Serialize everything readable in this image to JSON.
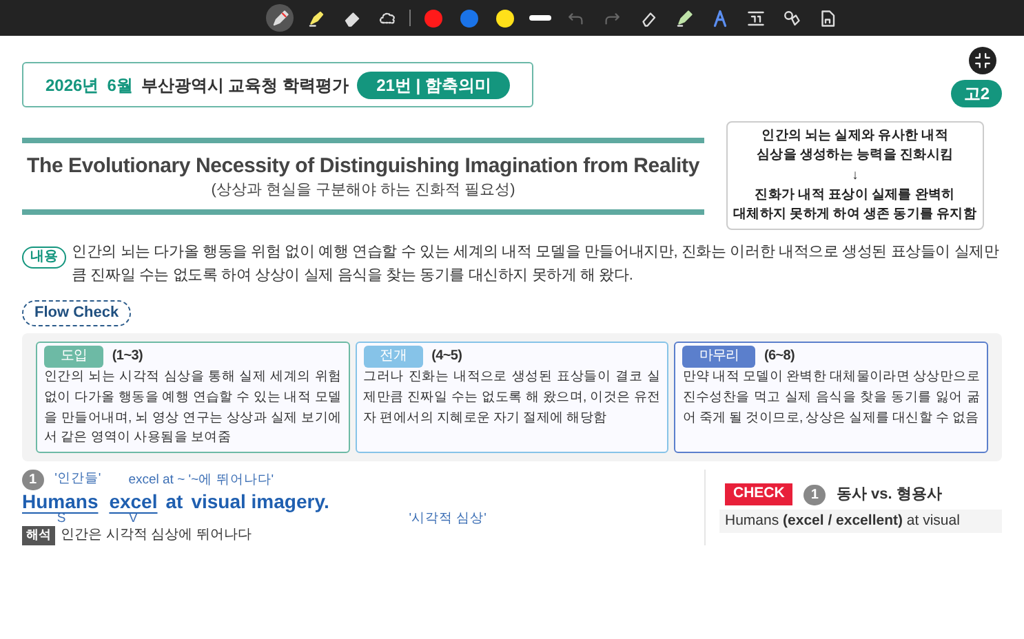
{
  "toolbar": {
    "tools": [
      {
        "kind": "pen",
        "selected": true
      },
      {
        "kind": "highlighter",
        "selected": false
      },
      {
        "kind": "eraser",
        "selected": false
      },
      {
        "kind": "lasso",
        "selected": false
      }
    ],
    "colors": [
      {
        "color": "#ff1a1a",
        "selected": false
      },
      {
        "color": "#1a73e8",
        "selected": false
      },
      {
        "color": "#ffe01a",
        "selected": false
      }
    ],
    "stroke": {
      "selected": false
    },
    "history": [
      {
        "kind": "undo",
        "disabled": true
      },
      {
        "kind": "redo",
        "disabled": true
      }
    ],
    "extras": [
      {
        "kind": "clear"
      },
      {
        "kind": "marker"
      },
      {
        "kind": "text-style"
      },
      {
        "kind": "textbox"
      },
      {
        "kind": "shapes"
      },
      {
        "kind": "page"
      }
    ]
  },
  "header": {
    "year": "2026년",
    "month": "6월",
    "exam": "부산광역시 교육청 학력평가",
    "badge": "21번 | 함축의미",
    "grade": "고2"
  },
  "title": {
    "english": "The Evolutionary Necessity of Distinguishing Imagination from Reality",
    "korean": "(상상과 현실을 구분해야 하는 진화적 필요성)"
  },
  "summary": [
    "인간의 뇌는 실제와 유사한 내적",
    "심상을 생성하는 능력을 진화시킴",
    "↓",
    "진화가 내적 표상이 실제를 완벽히",
    "대체하지 못하게 하여 생존 동기를 유지함"
  ],
  "content": {
    "label": "내용",
    "text": "인간의 뇌는 다가올 행동을 위험 없이 예행 연습할 수 있는 세계의 내적 모델을 만들어내지만, 진화는 이러한 내적으로 생성된 표상들이 실제만큼 진짜일 수는 없도록 하여 상상이 실제 음식을 찾는 동기를 대신하지 못하게 해 왔다."
  },
  "flow_check": {
    "label": "Flow Check",
    "stages": [
      {
        "label": "도입",
        "range": "(1~3)",
        "color": "#6dbaa5",
        "text": "인간의 뇌는 시각적 심상을 통해 실제 세계의 위험 없이 다가올 행동을 예행 연습할 수 있는 내적 모델을 만들어내며, 뇌 영상 연구는 상상과 실제 보기에서 같은 영역이 사용됨을 보여줌"
      },
      {
        "label": "전개",
        "range": "(4~5)",
        "color": "#86c3e8",
        "text": "그러나 진화는 내적으로 생성된 표상들이 결코 실제만큼 진짜일 수는 없도록 해 왔으며, 이것은 유전자 편에서의 지혜로운 자기 절제에 해당함"
      },
      {
        "label": "마무리",
        "range": "(6~8)",
        "color": "#5b7fcc",
        "text": "만약 내적 모델이 완벽한 대체물이라면 상상만으로 진수성찬을 먹고 실제 음식을 찾을 동기를 잃어 굶어 죽게 될 것이므로, 상상은 실제를 대신할 수 없음"
      }
    ]
  },
  "sentence": {
    "number": "1",
    "words": [
      {
        "word": "Humans",
        "above": "'인간들'",
        "below": "S",
        "underlined": true
      },
      {
        "word": "excel",
        "above": "excel at ~ '~에 뛰어나다'",
        "below": "V",
        "underlined": true
      },
      {
        "word": "at",
        "underlined": false
      },
      {
        "word": "visual imagery.",
        "below": "'시각적 심상'",
        "underlined": false
      }
    ],
    "translation_label": "해석",
    "translation": "인간은 시각적 심상에 뛰어나다"
  },
  "check": {
    "tag": "CHECK",
    "number": "1",
    "title": "동사 vs. 형용사",
    "text": "Humans **(excel / excellent)** at visual"
  }
}
